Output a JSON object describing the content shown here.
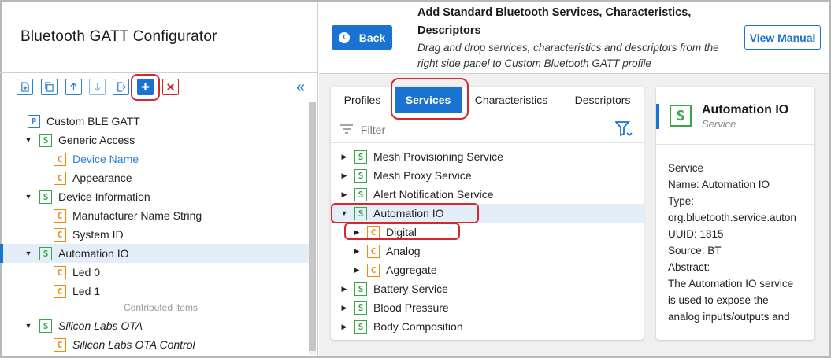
{
  "app": {
    "title": "Bluetooth GATT Configurator"
  },
  "toolbar": {
    "buttons": [
      {
        "name": "import-file-icon"
      },
      {
        "name": "copy-icon"
      },
      {
        "name": "arrow-up-icon"
      },
      {
        "name": "arrow-down-icon"
      },
      {
        "name": "export-icon"
      },
      {
        "name": "plus-icon"
      },
      {
        "name": "delete-icon"
      }
    ],
    "collapse_icon": "«",
    "colors": {
      "accent": "#1a73d0",
      "danger": "#c9272f",
      "highlight": "#d8262e"
    }
  },
  "tree": {
    "items": [
      {
        "label": "Custom BLE GATT",
        "badge": "P",
        "level": 0,
        "expanded": null
      },
      {
        "label": "Generic Access",
        "badge": "S",
        "level": 1,
        "expanded": true
      },
      {
        "label": "Device Name",
        "badge": "C",
        "level": 2,
        "style": "link"
      },
      {
        "label": "Appearance",
        "badge": "C",
        "level": 2
      },
      {
        "label": "Device Information",
        "badge": "S",
        "level": 1,
        "expanded": true
      },
      {
        "label": "Manufacturer Name String",
        "badge": "C",
        "level": 2
      },
      {
        "label": "System ID",
        "badge": "C",
        "level": 2
      },
      {
        "label": "Automation IO",
        "badge": "S",
        "level": 1,
        "expanded": true,
        "selected": true
      },
      {
        "label": "Led 0",
        "badge": "C",
        "level": 2
      },
      {
        "label": "Led 1",
        "badge": "C",
        "level": 2
      },
      {
        "label": "Silicon Labs OTA",
        "badge": "S",
        "level": 1,
        "expanded": true,
        "style": "italic"
      },
      {
        "label": "Silicon Labs OTA Control",
        "badge": "C",
        "level": 2,
        "style": "italic"
      }
    ],
    "contributed_label": "Contributed items"
  },
  "header": {
    "back_label": "Back",
    "title": "Add Standard Bluetooth Services, Characteristics, Descriptors",
    "subtitle": "Drag and drop services, characteristics and descriptors from the right side panel to Custom Bluetooth GATT profile",
    "view_manual_label": "View Manual"
  },
  "tabs": [
    {
      "label": "Profiles",
      "active": false
    },
    {
      "label": "Services",
      "active": true
    },
    {
      "label": "Characteristics",
      "active": false
    },
    {
      "label": "Descriptors",
      "active": false
    }
  ],
  "filter": {
    "placeholder": "Filter"
  },
  "services": [
    {
      "label": "Mesh Provisioning Service",
      "badge": "S",
      "level": 0,
      "expanded": false
    },
    {
      "label": "Mesh Proxy Service",
      "badge": "S",
      "level": 0,
      "expanded": false
    },
    {
      "label": "Alert Notification Service",
      "badge": "S",
      "level": 0,
      "expanded": false
    },
    {
      "label": "Automation IO",
      "badge": "S",
      "level": 0,
      "expanded": true,
      "selected": true
    },
    {
      "label": "Digital",
      "badge": "C",
      "level": 1,
      "expanded": false
    },
    {
      "label": "Analog",
      "badge": "C",
      "level": 1,
      "expanded": false
    },
    {
      "label": "Aggregate",
      "badge": "C",
      "level": 1,
      "expanded": false
    },
    {
      "label": "Battery Service",
      "badge": "S",
      "level": 0,
      "expanded": false
    },
    {
      "label": "Blood Pressure",
      "badge": "S",
      "level": 0,
      "expanded": false
    },
    {
      "label": "Body Composition",
      "badge": "S",
      "level": 0,
      "expanded": false
    }
  ],
  "detail": {
    "badge": "S",
    "name": "Automation IO",
    "type": "Service",
    "lines": [
      "Service",
      "Name: Automation IO",
      "Type:",
      "org.bluetooth.service.auton",
      "UUID: 1815",
      "Source: BT",
      "Abstract:",
      "The Automation IO service",
      "is used to expose the",
      "analog inputs/outputs and"
    ]
  }
}
